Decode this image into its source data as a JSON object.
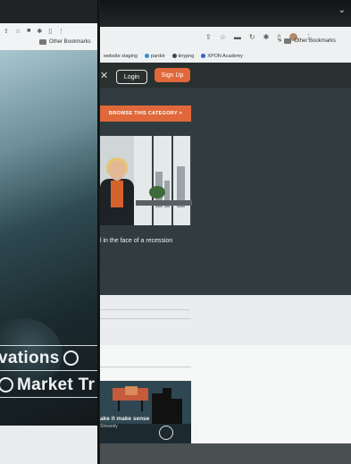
{
  "left_screen": {
    "bookmark_label": "Other Bookmarks",
    "hero_line1": "vations",
    "hero_line2": "Market Tr"
  },
  "right_screen": {
    "bookmark_label": "Other Bookmarks",
    "bookmarks": [
      "website staging",
      "pardot",
      "tinypng",
      "XPON Academy"
    ],
    "nav": {
      "login_label": "Login",
      "signup_label": "Sign Up"
    },
    "browse_label": "BROWSE THIS CATEGORY >",
    "headline": "l in the face of a recession",
    "card_caption": "ake it make sense",
    "card_sub": "Streamly"
  },
  "colors": {
    "accent": "#e0683a",
    "site_dark": "#313c40"
  }
}
